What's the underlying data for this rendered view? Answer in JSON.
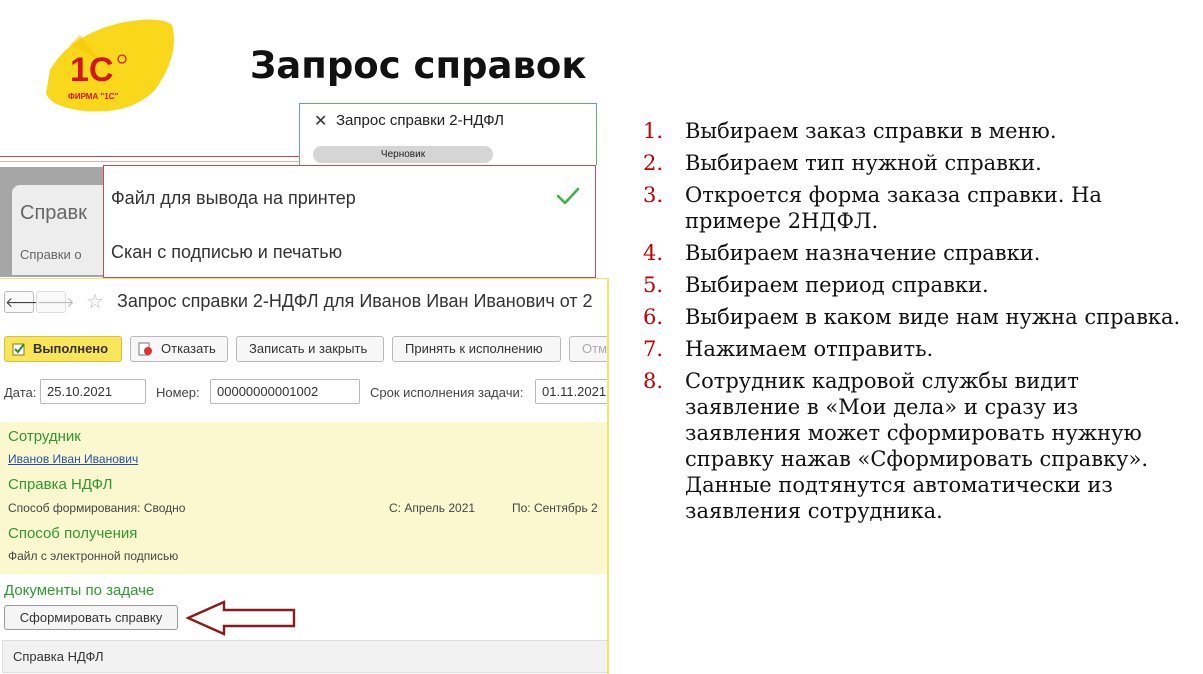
{
  "slide": {
    "title": "Запрос справок",
    "logo_text": "1С",
    "logo_sub": "ФИРМА \"1С\""
  },
  "request_popup": {
    "title": "Запрос справки 2-НДФЛ",
    "status": "Черновик"
  },
  "background_card": {
    "title": "Справк",
    "subtitle": "Справки о"
  },
  "dropdown": {
    "options": [
      "Файл для вывода на принтер",
      "Скан с подписью и печатью"
    ],
    "selected_index": 0
  },
  "form": {
    "title": "Запрос справки 2-НДФЛ для Иванов Иван Иванович от 2",
    "toolbar": {
      "done": "Выполнено",
      "refuse": "Отказать",
      "save_close": "Записать и закрыть",
      "accept": "Принять к исполнению",
      "cancel": "Отм"
    },
    "fields": {
      "date_label": "Дата:",
      "date_value": "25.10.2021",
      "number_label": "Номер:",
      "number_value": "00000000001002",
      "deadline_label": "Срок исполнения задачи:",
      "deadline_value": "01.11.2021"
    },
    "employee": {
      "section": "Сотрудник",
      "name": "Иванов Иван Иванович"
    },
    "ndfl": {
      "section": "Справка НДФЛ",
      "method": "Способ формирования:  Сводно",
      "from": "С:  Апрель 2021",
      "to": "По:  Сентябрь 2"
    },
    "receive": {
      "section": "Способ получения",
      "value": "Файл с электронной подписью"
    },
    "docs_title": "Документы по задаче",
    "generate_button": "Сформировать справку",
    "table_header": "Справка НДФЛ"
  },
  "steps": [
    {
      "num": "1.",
      "text": "Выбираем заказ справки в меню."
    },
    {
      "num": "2.",
      "text": "Выбираем тип нужной справки."
    },
    {
      "num": "3.",
      "text": "Откроется форма заказа справки. На примере 2НДФЛ."
    },
    {
      "num": "4.",
      "text": "Выбираем назначение справки."
    },
    {
      "num": "5.",
      "text": "Выбираем период справки."
    },
    {
      "num": "6.",
      "text": "Выбираем в каком виде нам нужна справка."
    },
    {
      "num": "7.",
      "text": "Нажимаем отправить."
    },
    {
      "num": "8.",
      "text": "Сотрудник кадровой службы видит заявление в «Мои дела» и сразу из заявления может сформировать нужную справку нажав «Сформировать справку». Данные подтянутся автоматически из заявления сотрудника."
    }
  ],
  "colors": {
    "accent_red": "#c00000",
    "section_green": "#2e9a2e",
    "panel_yellow": "#fbf8cf",
    "logo_yellow": "#f9d81c"
  }
}
